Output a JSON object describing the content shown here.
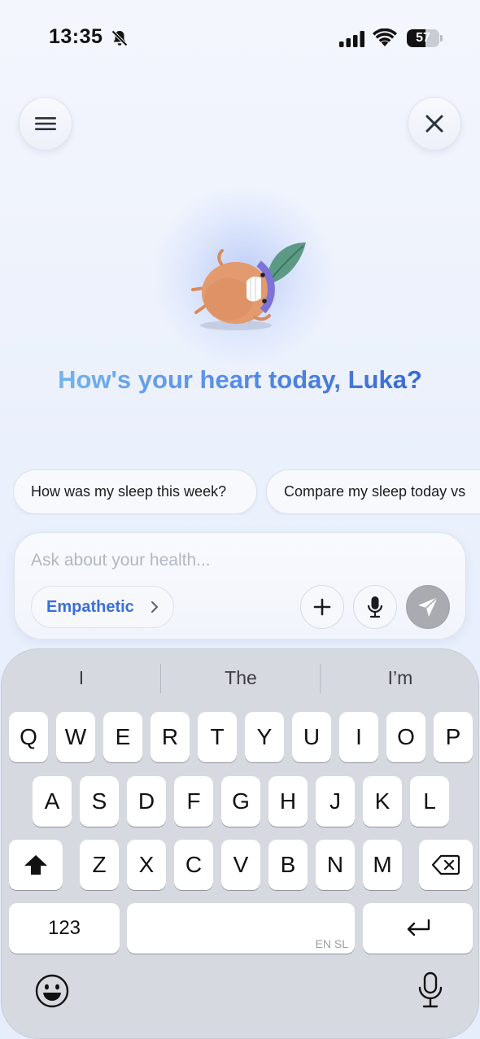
{
  "status": {
    "time": "13:35",
    "battery": "57",
    "battery_level": 0.57,
    "icons": [
      "bell-slash-icon",
      "cellular-signal-icon",
      "wifi-icon",
      "battery-icon"
    ]
  },
  "header": {
    "menu_icon": "hamburger-menu-icon",
    "close_icon": "close-x-icon"
  },
  "greeting": "How's your heart today, Luka?",
  "suggestions": [
    "How was my sleep this week?",
    "Compare my sleep today vs"
  ],
  "composer": {
    "placeholder": "Ask about your health...",
    "value": "",
    "mode_label": "Empathetic",
    "icons": [
      "chevron-right-icon",
      "plus-icon",
      "microphone-icon",
      "send-icon"
    ]
  },
  "keyboard": {
    "predictions": [
      "I",
      "The",
      "I’m"
    ],
    "row1": [
      "Q",
      "W",
      "E",
      "R",
      "T",
      "Y",
      "U",
      "I",
      "O",
      "P"
    ],
    "row2": [
      "A",
      "S",
      "D",
      "F",
      "G",
      "H",
      "J",
      "K",
      "L"
    ],
    "row3": [
      "Z",
      "X",
      "C",
      "V",
      "B",
      "N",
      "M"
    ],
    "numbers_label": "123",
    "space_lang": "EN SL",
    "icons": [
      "shift-icon",
      "delete-icon",
      "return-icon",
      "emoji-icon",
      "dictation-mic-icon"
    ]
  },
  "colors": {
    "accent": "#3a6fd8",
    "greeting_start": "#7cc2f0",
    "greeting_end": "#2f5fcf",
    "send_disabled": "#a9abb1"
  }
}
